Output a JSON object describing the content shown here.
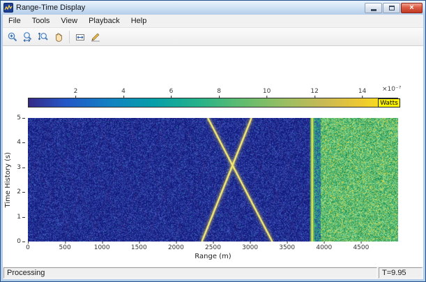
{
  "window": {
    "title": "Range-Time Display",
    "controls": {
      "close_glyph": "×"
    }
  },
  "menu": {
    "items": [
      "File",
      "Tools",
      "View",
      "Playback",
      "Help"
    ]
  },
  "toolbar": {
    "icons": [
      "zoom-in",
      "zoom-x",
      "zoom-y",
      "pan",
      "scale-axes",
      "measurements"
    ]
  },
  "status": {
    "left": "Processing",
    "right": "T=9.95"
  },
  "chart_data": {
    "type": "heatmap",
    "title": "",
    "xlabel": "Range (m)",
    "ylabel": "Time History (s)",
    "xlim": [
      0,
      5000
    ],
    "ylim": [
      0,
      5
    ],
    "x_ticks": [
      0,
      500,
      1000,
      1500,
      2000,
      2500,
      3000,
      3500,
      4000,
      4500
    ],
    "y_ticks": [
      0,
      1,
      2,
      3,
      4,
      5
    ],
    "grid": false,
    "colorbar": {
      "limits": [
        0,
        15.5
      ],
      "ticks": [
        2,
        4,
        6,
        8,
        10,
        12,
        14
      ],
      "scale_label": "×10⁻⁷",
      "unit_label": "Watts"
    },
    "features": {
      "background": "low-power dark-blue noise floor",
      "echo_lines": [
        {
          "from": [
            2350,
            0
          ],
          "to": [
            3020,
            5
          ]
        },
        {
          "from": [
            3300,
            0
          ],
          "to": [
            2430,
            5
          ]
        }
      ],
      "clutter_line_range": 3840,
      "clutter_region": [
        3950,
        5000
      ]
    }
  }
}
